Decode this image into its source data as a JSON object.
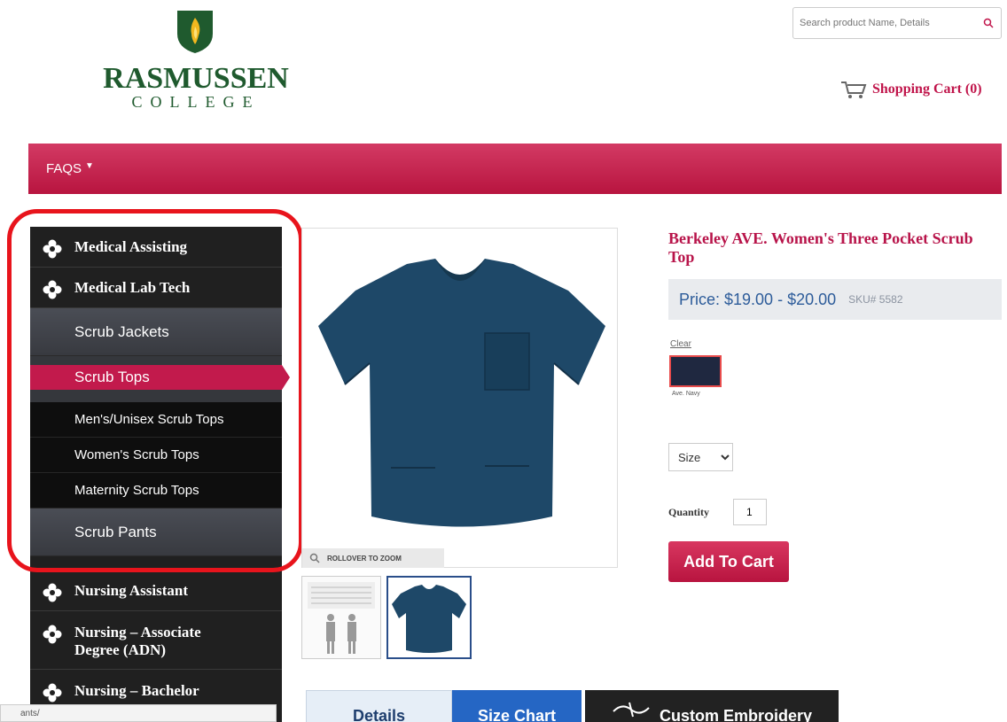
{
  "brand": {
    "name": "RASMUSSEN",
    "sub": "COLLEGE"
  },
  "search": {
    "placeholder": "Search product Name, Details"
  },
  "cart": {
    "label": "Shopping Cart (0)"
  },
  "nav": {
    "faqs": "FAQS"
  },
  "sidebar": {
    "categories": [
      {
        "label": "Medical Assisting"
      },
      {
        "label": "Medical Lab Tech"
      },
      {
        "label": "Nursing Assistant"
      },
      {
        "label": "Nursing – Associate Degree (ADN)"
      },
      {
        "label": "Nursing – Bachelor"
      }
    ],
    "subcategories": [
      {
        "label": "Scrub Jackets"
      },
      {
        "label": "Scrub Tops"
      },
      {
        "label": "Scrub Pants"
      }
    ],
    "subsubcategories": [
      {
        "label": "Men's/Unisex Scrub Tops"
      },
      {
        "label": "Women's Scrub Tops"
      },
      {
        "label": "Maternity Scrub Tops"
      }
    ]
  },
  "status": {
    "url": "ants/"
  },
  "product": {
    "title": "Berkeley AVE. Women's Three Pocket Scrub Top",
    "price": "Price: $19.00 - $20.00",
    "sku": "SKU# 5582",
    "clear": "Clear",
    "swatch_label": "Ave. Navy",
    "swatch_color": "#1f2840",
    "size_label": "Size",
    "quantity_label": "Quantity",
    "quantity_value": "1",
    "add_to_cart": "Add To Cart",
    "zoom_label": "ROLLOVER TO ZOOM"
  },
  "tabs": [
    {
      "label": "Details"
    },
    {
      "label": "Size Chart"
    },
    {
      "label": "Custom Embroidery"
    }
  ],
  "colors": {
    "accent": "#c21a4c",
    "price_blue": "#2d5c9a",
    "brand_green": "#1f5a2e",
    "highlight_red": "#e8141c"
  }
}
